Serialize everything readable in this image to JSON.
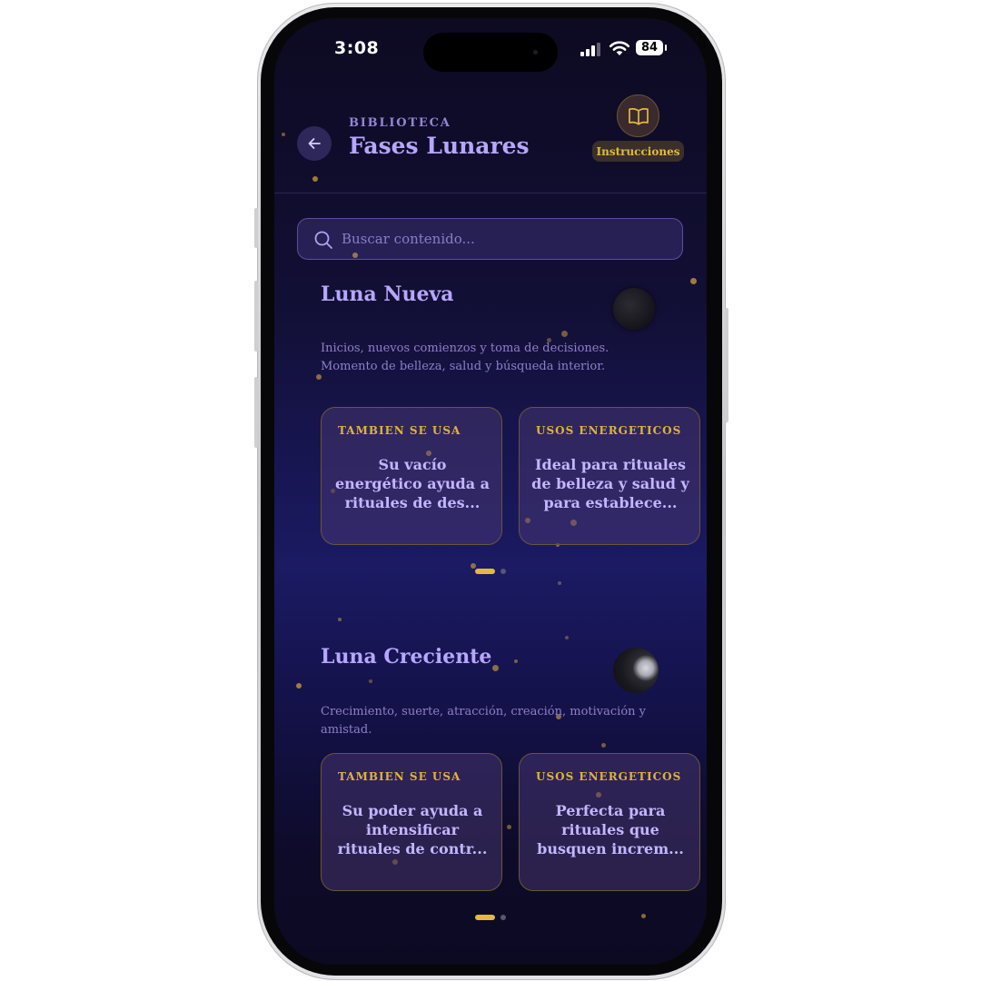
{
  "status_bar": {
    "time": "3:08",
    "battery": "84"
  },
  "header": {
    "kicker": "BIBLIOTECA",
    "title": "Fases Lunares",
    "instructions_label": "Instrucciones"
  },
  "search": {
    "placeholder": "Buscar contenido..."
  },
  "sections": [
    {
      "title": "Luna Nueva",
      "description": "Inicios, nuevos comienzos y toma de decisiones. Momento de belleza, salud y búsqueda interior.",
      "cards": [
        {
          "kicker": "TAMBIEN SE USA",
          "text": "Su vacío energético ayuda a rituales de des..."
        },
        {
          "kicker": "USOS ENERGETICOS",
          "text": "Ideal para rituales de belleza y salud y para establece..."
        }
      ]
    },
    {
      "title": "Luna Creciente",
      "description": "Crecimiento, suerte, atracción, creación, motivación y amistad.",
      "cards": [
        {
          "kicker": "TAMBIEN SE USA",
          "text": "Su poder ayuda a intensificar rituales de contr..."
        },
        {
          "kicker": "USOS ENERGETICOS",
          "text": "Perfecta para rituales que busquen increm..."
        }
      ]
    }
  ],
  "icons": {
    "back": "arrow-left-icon",
    "instructions": "open-book-icon",
    "search": "search-icon",
    "new_moon": "new-moon-icon",
    "crescent_moon": "crescent-moon-icon"
  },
  "colors": {
    "accent_gold": "#e6b83d",
    "title_lavender": "#b7a6ff",
    "background_top": "#0d0a22",
    "background_mid": "#1b1a63"
  }
}
